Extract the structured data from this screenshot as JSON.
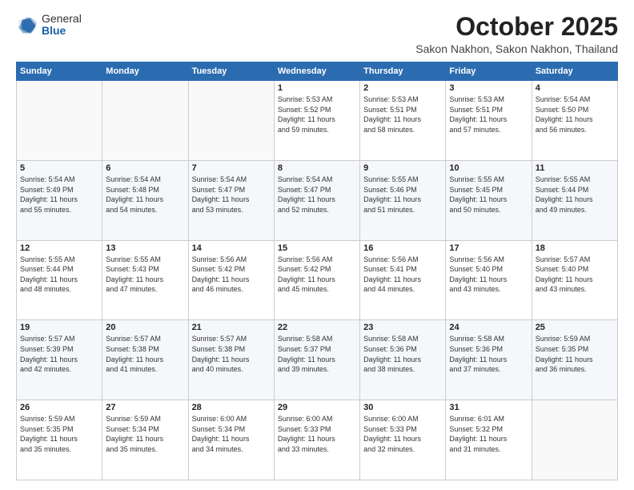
{
  "logo": {
    "general": "General",
    "blue": "Blue"
  },
  "title": "October 2025",
  "subtitle": "Sakon Nakhon, Sakon Nakhon, Thailand",
  "days_of_week": [
    "Sunday",
    "Monday",
    "Tuesday",
    "Wednesday",
    "Thursday",
    "Friday",
    "Saturday"
  ],
  "weeks": [
    [
      {
        "num": "",
        "info": ""
      },
      {
        "num": "",
        "info": ""
      },
      {
        "num": "",
        "info": ""
      },
      {
        "num": "1",
        "info": "Sunrise: 5:53 AM\nSunset: 5:52 PM\nDaylight: 11 hours\nand 59 minutes."
      },
      {
        "num": "2",
        "info": "Sunrise: 5:53 AM\nSunset: 5:51 PM\nDaylight: 11 hours\nand 58 minutes."
      },
      {
        "num": "3",
        "info": "Sunrise: 5:53 AM\nSunset: 5:51 PM\nDaylight: 11 hours\nand 57 minutes."
      },
      {
        "num": "4",
        "info": "Sunrise: 5:54 AM\nSunset: 5:50 PM\nDaylight: 11 hours\nand 56 minutes."
      }
    ],
    [
      {
        "num": "5",
        "info": "Sunrise: 5:54 AM\nSunset: 5:49 PM\nDaylight: 11 hours\nand 55 minutes."
      },
      {
        "num": "6",
        "info": "Sunrise: 5:54 AM\nSunset: 5:48 PM\nDaylight: 11 hours\nand 54 minutes."
      },
      {
        "num": "7",
        "info": "Sunrise: 5:54 AM\nSunset: 5:47 PM\nDaylight: 11 hours\nand 53 minutes."
      },
      {
        "num": "8",
        "info": "Sunrise: 5:54 AM\nSunset: 5:47 PM\nDaylight: 11 hours\nand 52 minutes."
      },
      {
        "num": "9",
        "info": "Sunrise: 5:55 AM\nSunset: 5:46 PM\nDaylight: 11 hours\nand 51 minutes."
      },
      {
        "num": "10",
        "info": "Sunrise: 5:55 AM\nSunset: 5:45 PM\nDaylight: 11 hours\nand 50 minutes."
      },
      {
        "num": "11",
        "info": "Sunrise: 5:55 AM\nSunset: 5:44 PM\nDaylight: 11 hours\nand 49 minutes."
      }
    ],
    [
      {
        "num": "12",
        "info": "Sunrise: 5:55 AM\nSunset: 5:44 PM\nDaylight: 11 hours\nand 48 minutes."
      },
      {
        "num": "13",
        "info": "Sunrise: 5:55 AM\nSunset: 5:43 PM\nDaylight: 11 hours\nand 47 minutes."
      },
      {
        "num": "14",
        "info": "Sunrise: 5:56 AM\nSunset: 5:42 PM\nDaylight: 11 hours\nand 46 minutes."
      },
      {
        "num": "15",
        "info": "Sunrise: 5:56 AM\nSunset: 5:42 PM\nDaylight: 11 hours\nand 45 minutes."
      },
      {
        "num": "16",
        "info": "Sunrise: 5:56 AM\nSunset: 5:41 PM\nDaylight: 11 hours\nand 44 minutes."
      },
      {
        "num": "17",
        "info": "Sunrise: 5:56 AM\nSunset: 5:40 PM\nDaylight: 11 hours\nand 43 minutes."
      },
      {
        "num": "18",
        "info": "Sunrise: 5:57 AM\nSunset: 5:40 PM\nDaylight: 11 hours\nand 43 minutes."
      }
    ],
    [
      {
        "num": "19",
        "info": "Sunrise: 5:57 AM\nSunset: 5:39 PM\nDaylight: 11 hours\nand 42 minutes."
      },
      {
        "num": "20",
        "info": "Sunrise: 5:57 AM\nSunset: 5:38 PM\nDaylight: 11 hours\nand 41 minutes."
      },
      {
        "num": "21",
        "info": "Sunrise: 5:57 AM\nSunset: 5:38 PM\nDaylight: 11 hours\nand 40 minutes."
      },
      {
        "num": "22",
        "info": "Sunrise: 5:58 AM\nSunset: 5:37 PM\nDaylight: 11 hours\nand 39 minutes."
      },
      {
        "num": "23",
        "info": "Sunrise: 5:58 AM\nSunset: 5:36 PM\nDaylight: 11 hours\nand 38 minutes."
      },
      {
        "num": "24",
        "info": "Sunrise: 5:58 AM\nSunset: 5:36 PM\nDaylight: 11 hours\nand 37 minutes."
      },
      {
        "num": "25",
        "info": "Sunrise: 5:59 AM\nSunset: 5:35 PM\nDaylight: 11 hours\nand 36 minutes."
      }
    ],
    [
      {
        "num": "26",
        "info": "Sunrise: 5:59 AM\nSunset: 5:35 PM\nDaylight: 11 hours\nand 35 minutes."
      },
      {
        "num": "27",
        "info": "Sunrise: 5:59 AM\nSunset: 5:34 PM\nDaylight: 11 hours\nand 35 minutes."
      },
      {
        "num": "28",
        "info": "Sunrise: 6:00 AM\nSunset: 5:34 PM\nDaylight: 11 hours\nand 34 minutes."
      },
      {
        "num": "29",
        "info": "Sunrise: 6:00 AM\nSunset: 5:33 PM\nDaylight: 11 hours\nand 33 minutes."
      },
      {
        "num": "30",
        "info": "Sunrise: 6:00 AM\nSunset: 5:33 PM\nDaylight: 11 hours\nand 32 minutes."
      },
      {
        "num": "31",
        "info": "Sunrise: 6:01 AM\nSunset: 5:32 PM\nDaylight: 11 hours\nand 31 minutes."
      },
      {
        "num": "",
        "info": ""
      }
    ]
  ]
}
